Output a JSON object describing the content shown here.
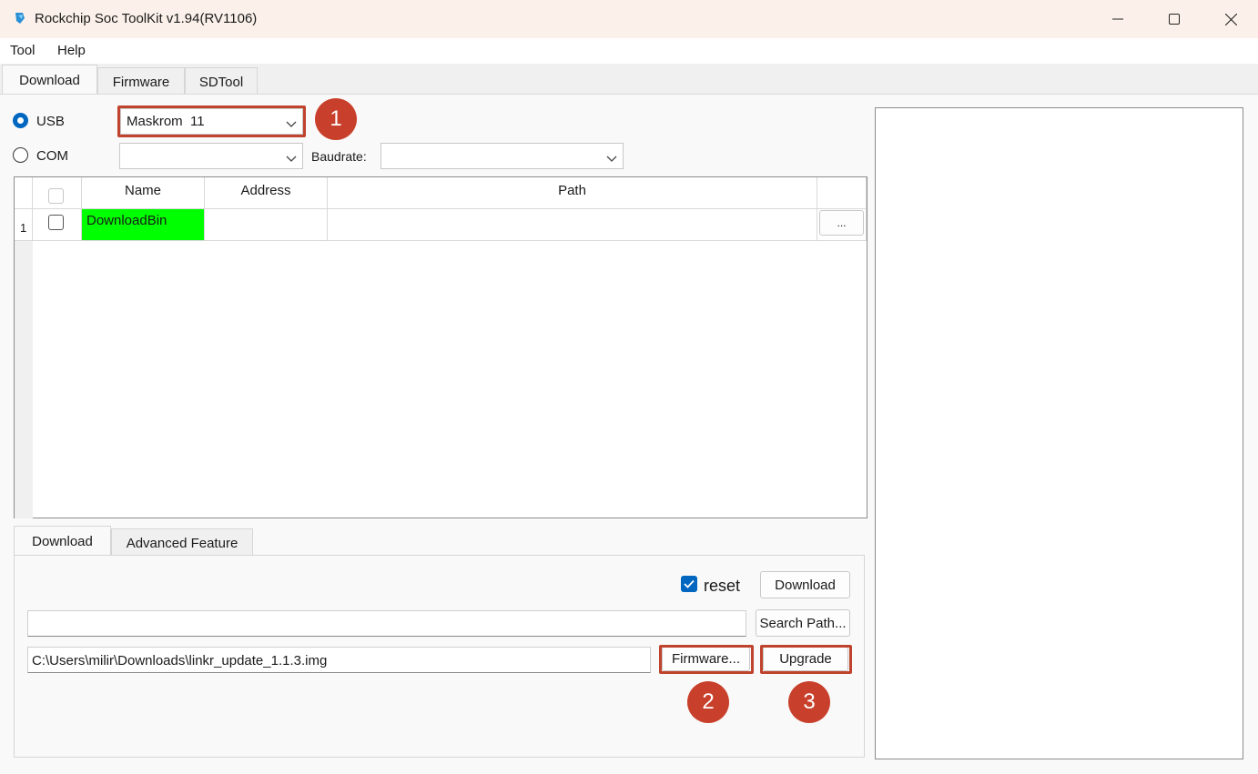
{
  "window": {
    "title": "Rockchip Soc ToolKit v1.94(RV1106)",
    "app_icon": "rockchip-app-icon"
  },
  "menu": {
    "tool": "Tool",
    "help": "Help"
  },
  "tabs": {
    "download": "Download",
    "firmware": "Firmware",
    "sdtool": "SDTool",
    "active": "Download"
  },
  "connection": {
    "usb_label": "USB",
    "usb_selected": true,
    "usb_device": "Maskrom  11",
    "com_label": "COM",
    "com_value": "",
    "baudrate_label": "Baudrate:",
    "baudrate_value": ""
  },
  "table": {
    "columns": {
      "name": "Name",
      "address": "Address",
      "path": "Path"
    },
    "rows": [
      {
        "index": "1",
        "checked": false,
        "name": "DownloadBin",
        "name_bg": "#00ff00",
        "address": "",
        "path": "",
        "browse": "..."
      }
    ]
  },
  "lower_tabs": {
    "download": "Download",
    "advanced": "Advanced Feature",
    "active": "Download"
  },
  "lower": {
    "reset_label": "reset",
    "reset_checked": true,
    "download_button": "Download",
    "search_path_value": "",
    "search_path_button": "Search Path...",
    "firmware_path": "C:\\Users\\milir\\Downloads\\linkr_update_1.1.3.img",
    "firmware_button": "Firmware...",
    "upgrade_button": "Upgrade"
  },
  "annotations": {
    "step1": "1",
    "step2": "2",
    "step3": "3",
    "color": "#c8402b"
  },
  "colors": {
    "accent": "#0067c0",
    "highlight": "#c0432d",
    "name_cell": "#00ff00"
  }
}
